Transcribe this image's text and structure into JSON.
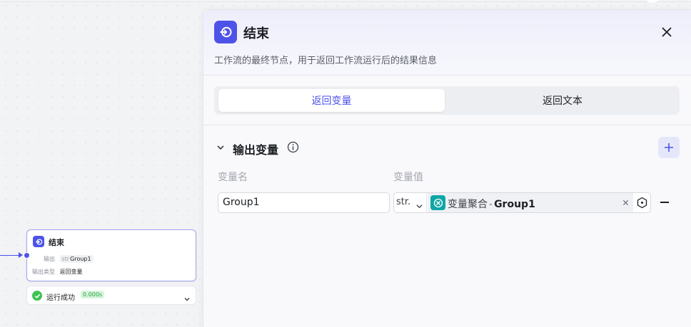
{
  "canvas": {
    "node": {
      "title": "结束",
      "output_label": "输出",
      "output_type_tag": "str",
      "output_value": "Group1",
      "output_kind_label": "输出类型",
      "output_kind_value": "返回变量"
    },
    "run": {
      "status": "运行成功",
      "time": "0.000s"
    }
  },
  "panel": {
    "title": "结束",
    "description": "工作流的最终节点，用于返回工作流运行后的结果信息",
    "tabs": [
      {
        "label": "返回变量",
        "active": true
      },
      {
        "label": "返回文本",
        "active": false
      }
    ],
    "section": {
      "title": "输出变量",
      "col_name": "变量名",
      "col_value": "变量值",
      "rows": [
        {
          "name": "Group1",
          "type": "str.",
          "ref_node": "变量聚合",
          "ref_sep": "-",
          "ref_var": "Group1"
        }
      ]
    }
  },
  "colors": {
    "brand": "#4d53e8",
    "success": "#3ec254",
    "ref_icon": "#0fa5a5"
  },
  "icons": {
    "node_icon": "end-node-icon",
    "close": "close-icon",
    "info": "info-icon",
    "add": "plus-icon",
    "chevron": "chevron-down-icon",
    "ref": "variable-merge-icon",
    "ref_select": "variable-select-icon",
    "remove": "minus-icon",
    "check": "check-circle-icon"
  }
}
